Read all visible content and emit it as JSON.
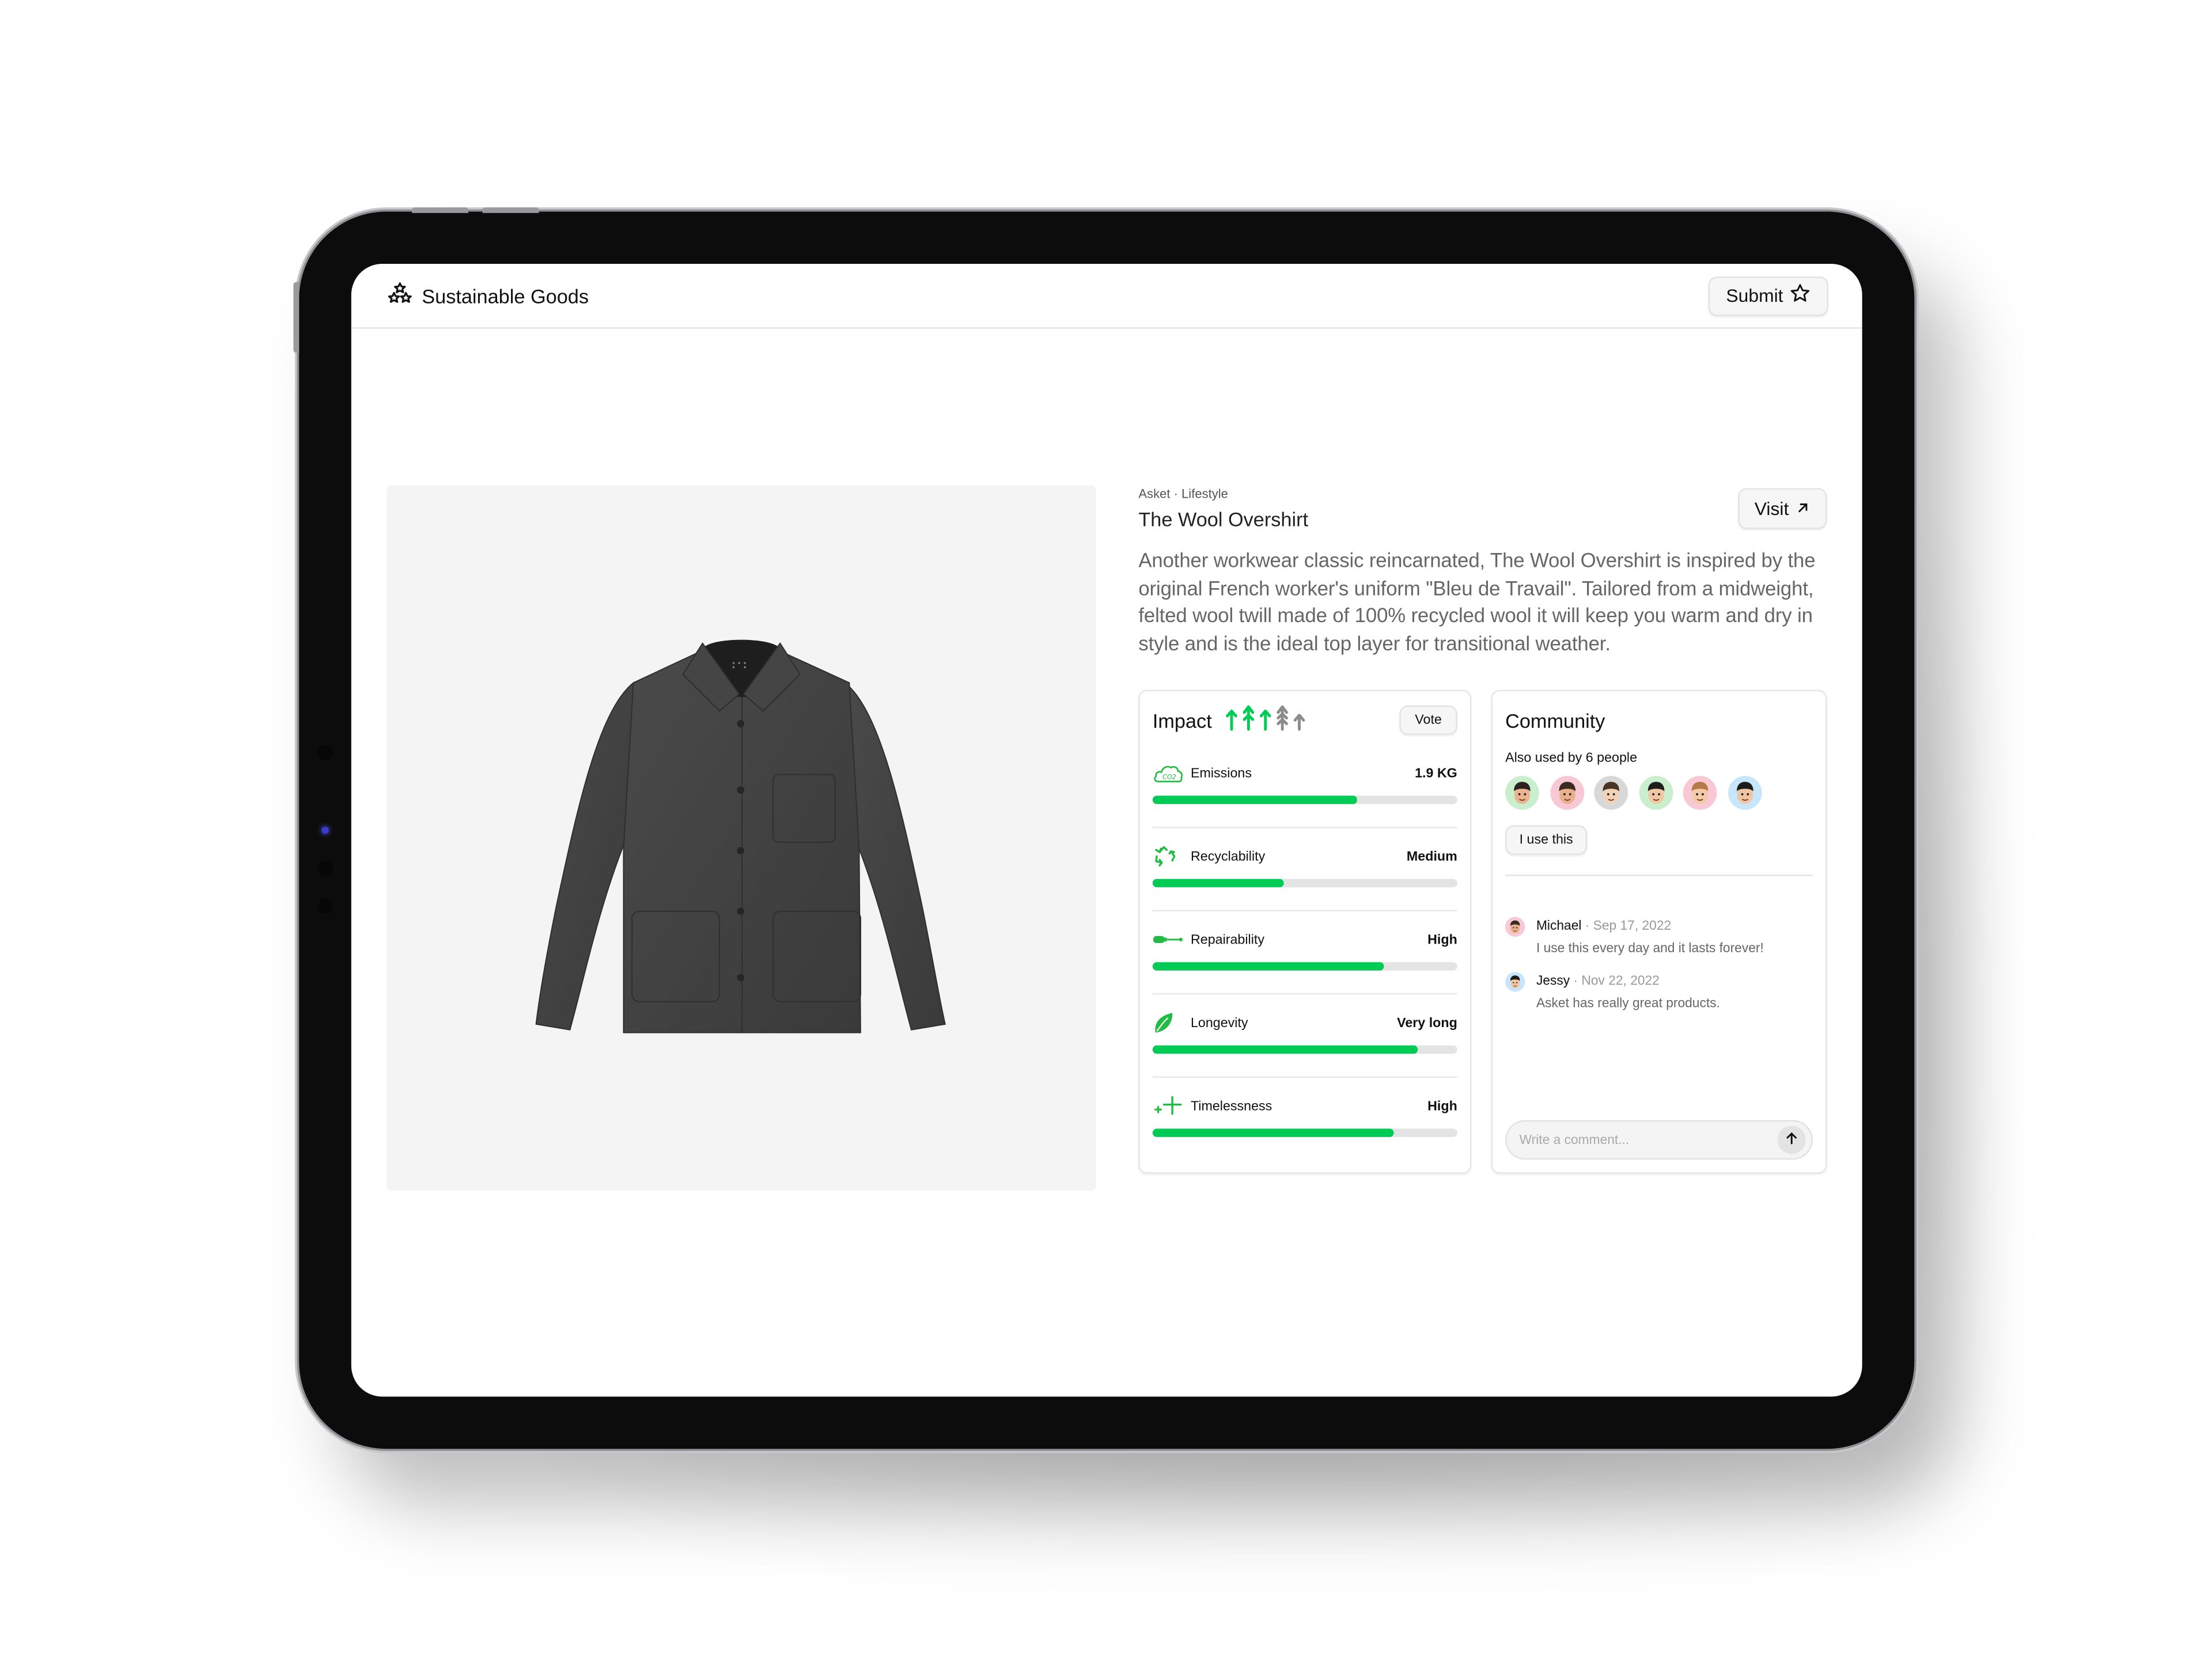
{
  "app": {
    "title": "Sustainable Goods",
    "logo_icon": "three-stars-icon",
    "submit_label": "Submit",
    "submit_icon": "star-outline-icon"
  },
  "product": {
    "breadcrumb": "Asket · Lifestyle",
    "name": "The Wool Overshirt",
    "visit_label": "Visit",
    "visit_icon": "arrow-up-right-icon",
    "description": "Another workwear classic reincarnated, The Wool Overshirt is inspired by the original French worker's uniform \"Bleu de Travail\". Tailored from a midweight, felted wool twill made of 100% recycled wool it will keep you warm and dry in style and is the ideal top layer for transitional weather.",
    "image": "grey-wool-overshirt-photo"
  },
  "impact": {
    "title": "Impact",
    "vote_label": "Vote",
    "tree_rating": {
      "filled": 3,
      "total": 5
    },
    "accent_color": "#00cc55",
    "inactive_color": "#8c8c8c",
    "metrics": [
      {
        "label": "Emissions",
        "value": "1.9 KG",
        "icon": "co2-cloud-icon",
        "progress": 0.67
      },
      {
        "label": "Recyclability",
        "value": "Medium",
        "icon": "recycle-icon",
        "progress": 0.43
      },
      {
        "label": "Repairability",
        "value": "High",
        "icon": "screwdriver-icon",
        "progress": 0.76
      },
      {
        "label": "Longevity",
        "value": "Very long",
        "icon": "leaf-icon",
        "progress": 0.87
      },
      {
        "label": "Timelessness",
        "value": "High",
        "icon": "sparkle-plus-icon",
        "progress": 0.79
      }
    ]
  },
  "community": {
    "title": "Community",
    "used_by": "Also used by 6 people",
    "use_label": "I use this",
    "avatars": [
      {
        "bg": "#c9efcd"
      },
      {
        "bg": "#f8c8d4"
      },
      {
        "bg": "#d8d8d8"
      },
      {
        "bg": "#c9efcd"
      },
      {
        "bg": "#f8c8d4"
      },
      {
        "bg": "#c8e6fa"
      }
    ],
    "comments": [
      {
        "name": "Michael",
        "separator": " · ",
        "date": "Sep 17, 2022",
        "text": "I use this every day and it lasts forever!",
        "avatar_bg": "#f8c8d4"
      },
      {
        "name": "Jessy",
        "separator": " · ",
        "date": "Nov 22, 2022",
        "text": "Asket has really great products.",
        "avatar_bg": "#c8e6fa"
      }
    ],
    "comment_placeholder": "Write a comment...",
    "send_icon": "arrow-up-icon"
  }
}
